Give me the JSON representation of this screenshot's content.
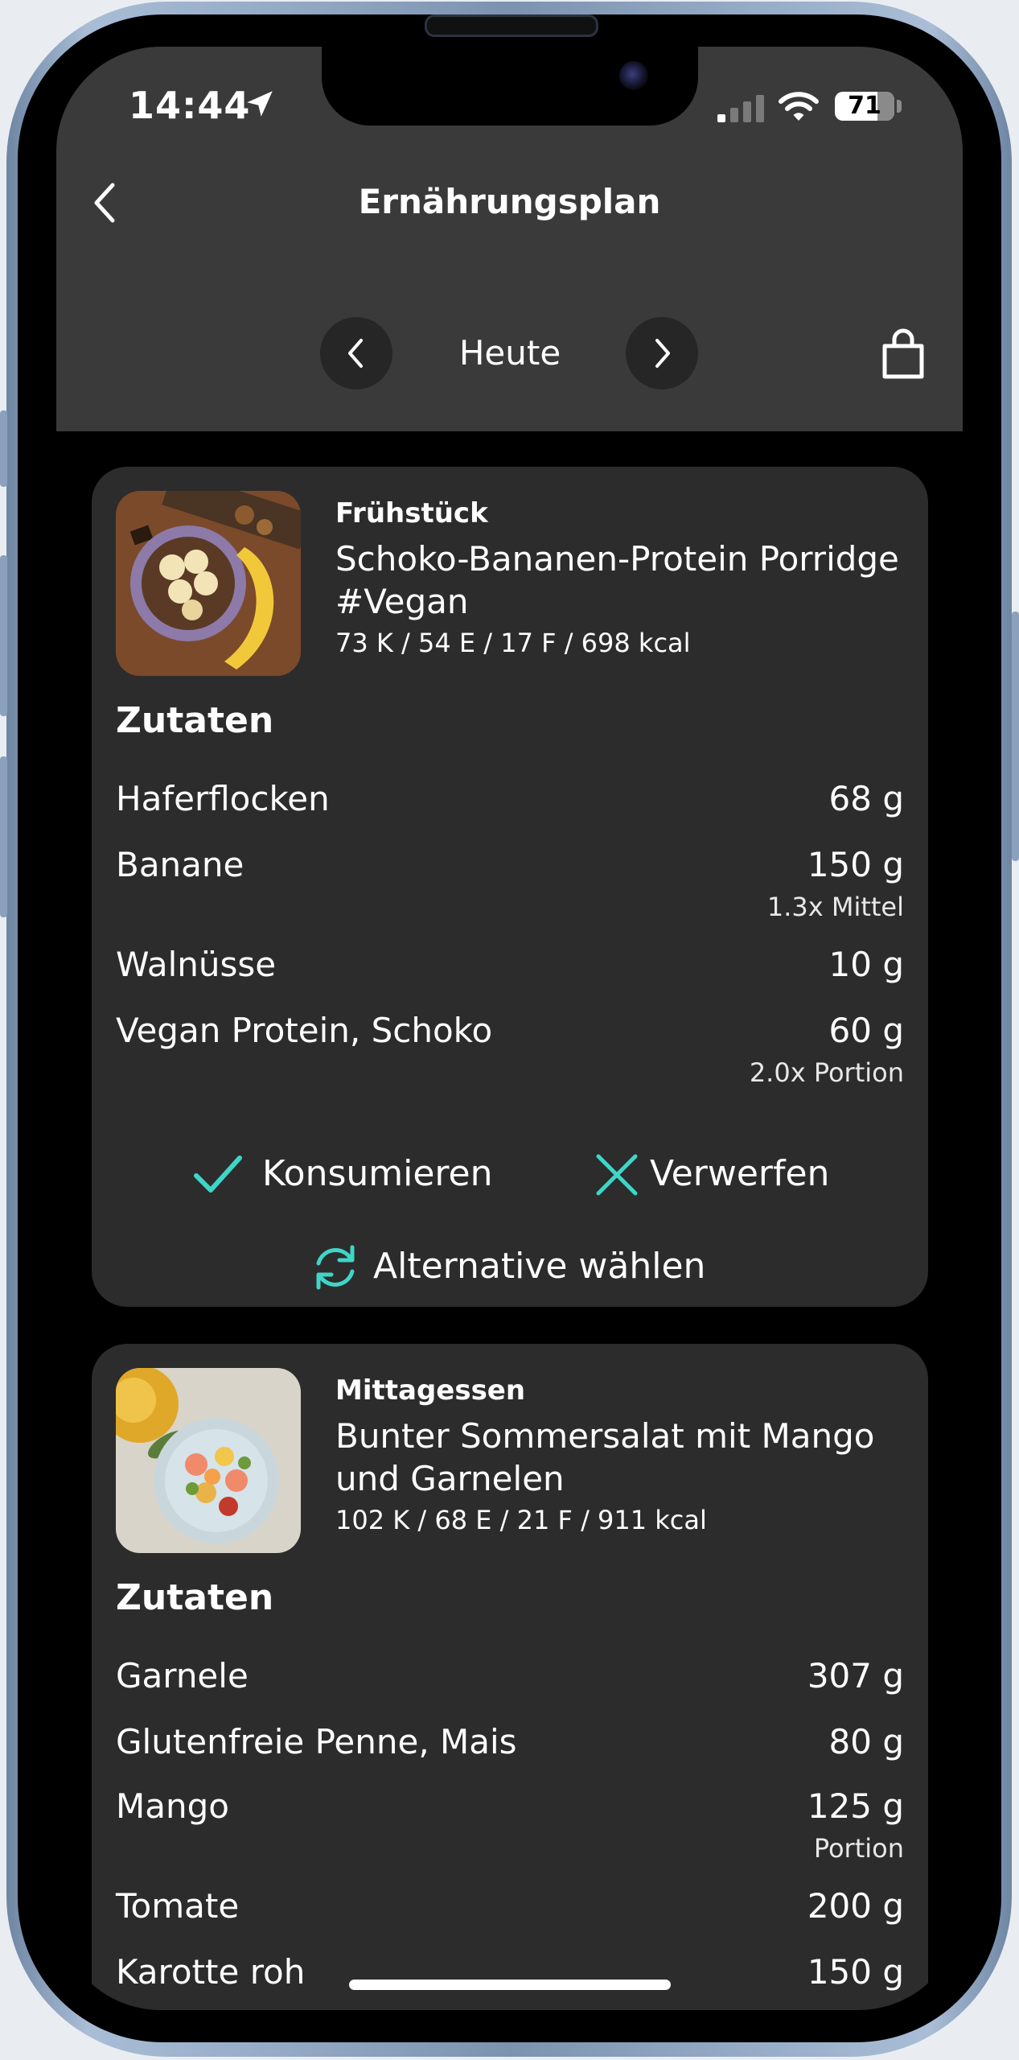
{
  "status_bar": {
    "time": "14:44",
    "battery": "71",
    "battery_level": 0.71,
    "icons": [
      "location-arrow-icon",
      "cellular-signal-icon",
      "wifi-icon",
      "battery-icon"
    ]
  },
  "header": {
    "title": "Ernährungsplan",
    "date_label": "Heute",
    "icons": [
      "back-chevron-icon",
      "chevron-left-icon",
      "chevron-right-icon",
      "shopping-bag-icon"
    ]
  },
  "meals": [
    {
      "type": "Frühstück",
      "name": "Schoko-Bananen-Protein Porridge #Vegan",
      "macros": "73 K / 54 E / 17 F / 698 kcal",
      "ingredients_heading": "Zutaten",
      "ingredients": [
        {
          "name": "Haferflocken",
          "amount": "68 g",
          "note": ""
        },
        {
          "name": "Banane",
          "amount": "150 g",
          "note": "1.3x Mittel"
        },
        {
          "name": "Walnüsse",
          "amount": "10 g",
          "note": ""
        },
        {
          "name": "Vegan Protein, Schoko",
          "amount": "60 g",
          "note": "2.0x Portion"
        }
      ],
      "actions": {
        "consume": "Konsumieren",
        "discard": "Verwerfen",
        "alternative": "Alternative wählen"
      }
    },
    {
      "type": "Mittagessen",
      "name": "Bunter Sommersalat mit Mango und Garnelen",
      "macros": "102 K / 68 E / 21 F / 911 kcal",
      "ingredients_heading": "Zutaten",
      "ingredients": [
        {
          "name": "Garnele",
          "amount": "307 g",
          "note": ""
        },
        {
          "name": "Glutenfreie Penne, Mais",
          "amount": "80 g",
          "note": ""
        },
        {
          "name": "Mango",
          "amount": "125 g",
          "note": "Portion"
        },
        {
          "name": "Tomate",
          "amount": "200 g",
          "note": ""
        },
        {
          "name": "Karotte roh",
          "amount": "150 g",
          "note": ""
        }
      ]
    }
  ],
  "colors": {
    "header_bg": "#3a3a3a",
    "card_bg": "#2c2c2c",
    "accent": "#3fd6c8"
  }
}
